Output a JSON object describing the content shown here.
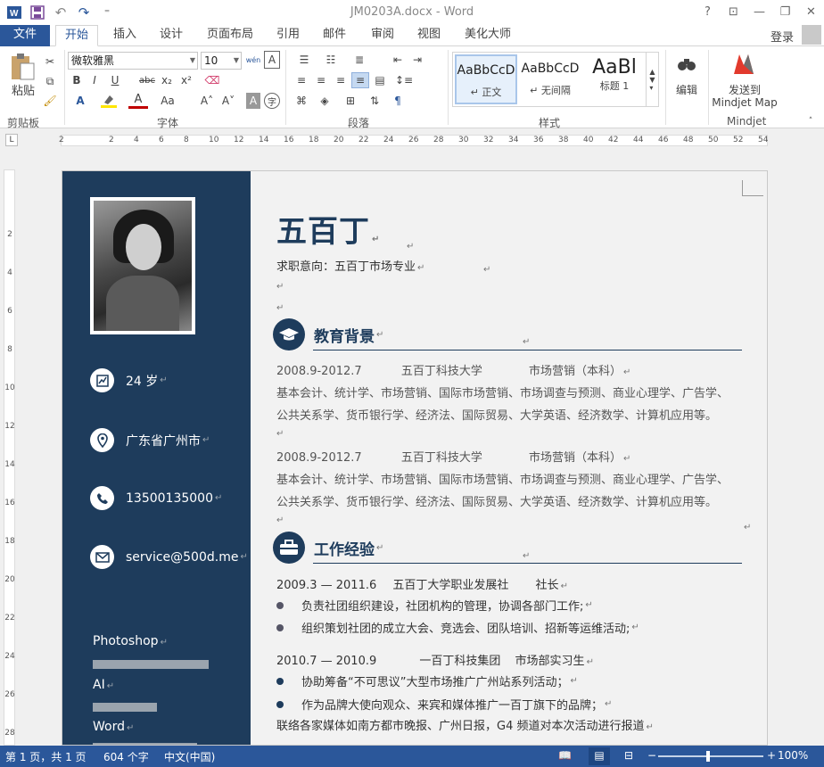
{
  "window": {
    "title": "JM0203A.docx - Word",
    "help": "?",
    "minimize": "—",
    "restore": "❐",
    "close": "✕",
    "ribbon_opts": "⊡"
  },
  "qat": {
    "undo": "↶",
    "redo": "↷",
    "more": "⁼"
  },
  "tabs": [
    {
      "label": "文件"
    },
    {
      "label": "开始"
    },
    {
      "label": "插入"
    },
    {
      "label": "设计"
    },
    {
      "label": "页面布局"
    },
    {
      "label": "引用"
    },
    {
      "label": "邮件"
    },
    {
      "label": "审阅"
    },
    {
      "label": "视图"
    },
    {
      "label": "美化大师"
    }
  ],
  "account": {
    "login": "登录"
  },
  "ribbon": {
    "clipboard": {
      "label": "剪贴板",
      "paste": "粘贴"
    },
    "font": {
      "label": "字体",
      "family": "微软雅黑",
      "size": "10",
      "bold": "B",
      "italic": "I",
      "underline": "U",
      "strike": "abc",
      "sub": "x₂",
      "sup": "x²",
      "font_color": "A",
      "grow": "A˄",
      "shrink": "A˅",
      "case": "Aa",
      "clear": "A",
      "wen": "wén",
      "box": "A",
      "shade": "A"
    },
    "paragraph": {
      "label": "段落"
    },
    "styles": {
      "label": "样式",
      "items": [
        {
          "preview": "AaBbCcD",
          "name": "↵ 正文"
        },
        {
          "preview": "AaBbCcD",
          "name": "↵ 无间隔"
        },
        {
          "preview": "AaBl",
          "name": "标题 1"
        }
      ]
    },
    "editing": {
      "label": "编辑"
    },
    "mindjet": {
      "label": "Mindjet",
      "send": "发送到",
      "target": "Mindjet Map"
    }
  },
  "ruler": {
    "h_numbers": [
      "2",
      "2",
      "4",
      "6",
      "8",
      "10",
      "12",
      "14",
      "16",
      "18",
      "20",
      "22",
      "24",
      "26",
      "28",
      "30",
      "32",
      "34",
      "36",
      "38",
      "40",
      "42",
      "44",
      "46",
      "48",
      "50",
      "52",
      "54"
    ],
    "v_numbers": [
      "2",
      "4",
      "6",
      "8",
      "10",
      "12",
      "14",
      "16",
      "18",
      "20",
      "22",
      "24",
      "26",
      "28"
    ]
  },
  "resume": {
    "name": "五百丁",
    "intent": "求职意向：五百丁市场专业",
    "contact": {
      "age": "24 岁",
      "location": "广东省广州市",
      "phone": "13500135000",
      "email": "service@500d.me"
    },
    "skills": [
      {
        "name": "Photoshop",
        "level": 0.72
      },
      {
        "name": "AI",
        "level": 0.4
      },
      {
        "name": "Word",
        "level": 0.65
      }
    ],
    "education": {
      "title": "教育背景",
      "entries": [
        {
          "period": "2008.9-2012.7",
          "school": "五百丁科技大学",
          "major": "市场营销（本科）",
          "line1": "基本会计、统计学、市场营销、国际市场营销、市场调查与预测、商业心理学、广告学、",
          "line2": "公共关系学、货币银行学、经济法、国际贸易、大学英语、经济数学、计算机应用等。"
        },
        {
          "period": "2008.9-2012.7",
          "school": "五百丁科技大学",
          "major": "市场营销（本科）",
          "line1": "基本会计、统计学、市场营销、国际市场营销、市场调查与预测、商业心理学、广告学、",
          "line2": "公共关系学、货币银行学、经济法、国际贸易、大学英语、经济数学、计算机应用等。"
        }
      ]
    },
    "work": {
      "title": "工作经验",
      "entries": [
        {
          "period": "2009.3 — 2011.6",
          "org": "五百丁大学职业发展社",
          "role": "社长",
          "bullets": [
            "负责社团组织建设，社团机构的管理，协调各部门工作;",
            "组织策划社团的成立大会、竞选会、团队培训、招新等运维活动;"
          ]
        },
        {
          "period": "2010.7 — 2010.9",
          "org": "一百丁科技集团",
          "role": "市场部实习生",
          "bullets": [
            "协助筹备“不可思议”大型市场推广广州站系列活动；",
            "作为品牌大使向观众、来宾和媒体推广一百丁旗下的品牌；"
          ],
          "extra": "联络各家媒体如南方都市晚报、广州日报，G4 频道对本次活动进行报道"
        }
      ]
    }
  },
  "status": {
    "page": "第 1 页，共 1 页",
    "words": "604 个字",
    "lang": "中文(中国)",
    "zoom": "100%",
    "minus": "−",
    "plus": "+"
  },
  "marks": {
    "para": "↵",
    "return": "↵"
  }
}
